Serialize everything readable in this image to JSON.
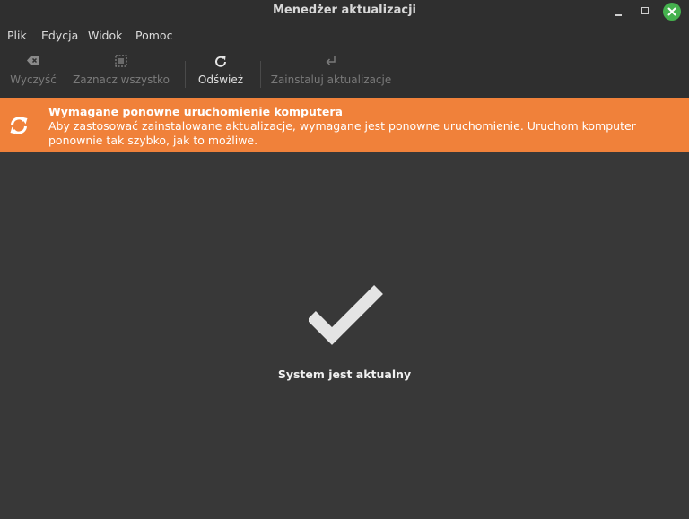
{
  "window": {
    "title": "Menedżer aktualizacji"
  },
  "menubar": {
    "items": [
      "Plik",
      "Edycja",
      "Widok",
      "Pomoc"
    ]
  },
  "toolbar": {
    "clear_label": "Wyczyść",
    "select_all_label": "Zaznacz wszystko",
    "refresh_label": "Odśwież",
    "install_label": "Zainstaluj aktualizacje"
  },
  "banner": {
    "title": "Wymagane ponowne uruchomienie komputera",
    "message": "Aby zastosować zainstalowane aktualizacje, wymagane jest ponowne uruchomienie. Uruchom komputer ponownie tak szybko, jak to możliwe.",
    "color": "#f0813a"
  },
  "status": {
    "text": "System jest aktualny"
  },
  "icons": {
    "clear": "clear-backspace-icon",
    "select_all": "select-all-icon",
    "refresh": "refresh-icon",
    "install": "install-return-icon",
    "banner": "restart-icon",
    "status": "checkmark-icon"
  }
}
